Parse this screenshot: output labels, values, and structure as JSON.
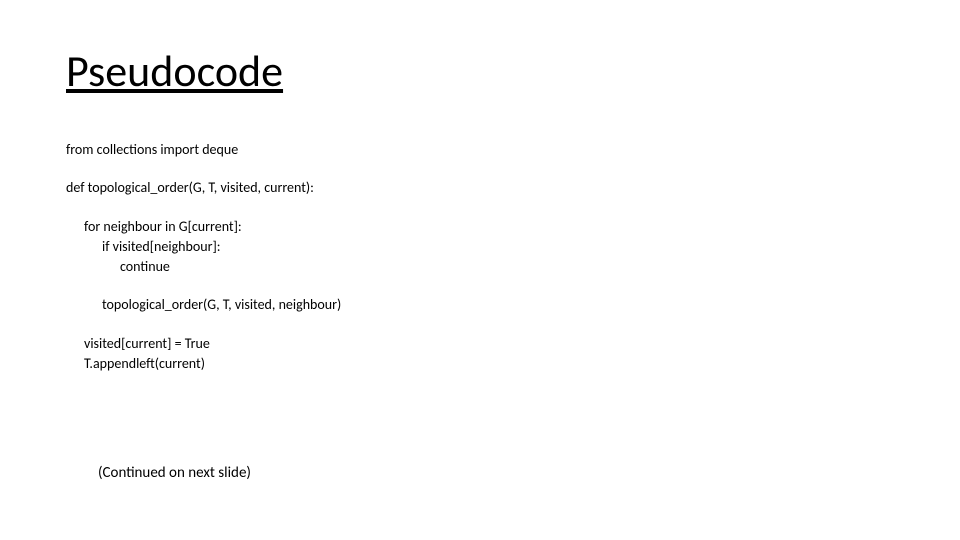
{
  "title": "Pseudocode",
  "code": {
    "l1": "from collections import deque",
    "l2": "def topological_order(G, T, visited, current):",
    "l3": "for neighbour in G[current]:",
    "l4": "if visited[neighbour]:",
    "l5": "continue",
    "l6": "topological_order(G, T, visited, neighbour)",
    "l7": "visited[current] = True",
    "l8": "T.appendleft(current)"
  },
  "footer": "(Continued on next slide)"
}
